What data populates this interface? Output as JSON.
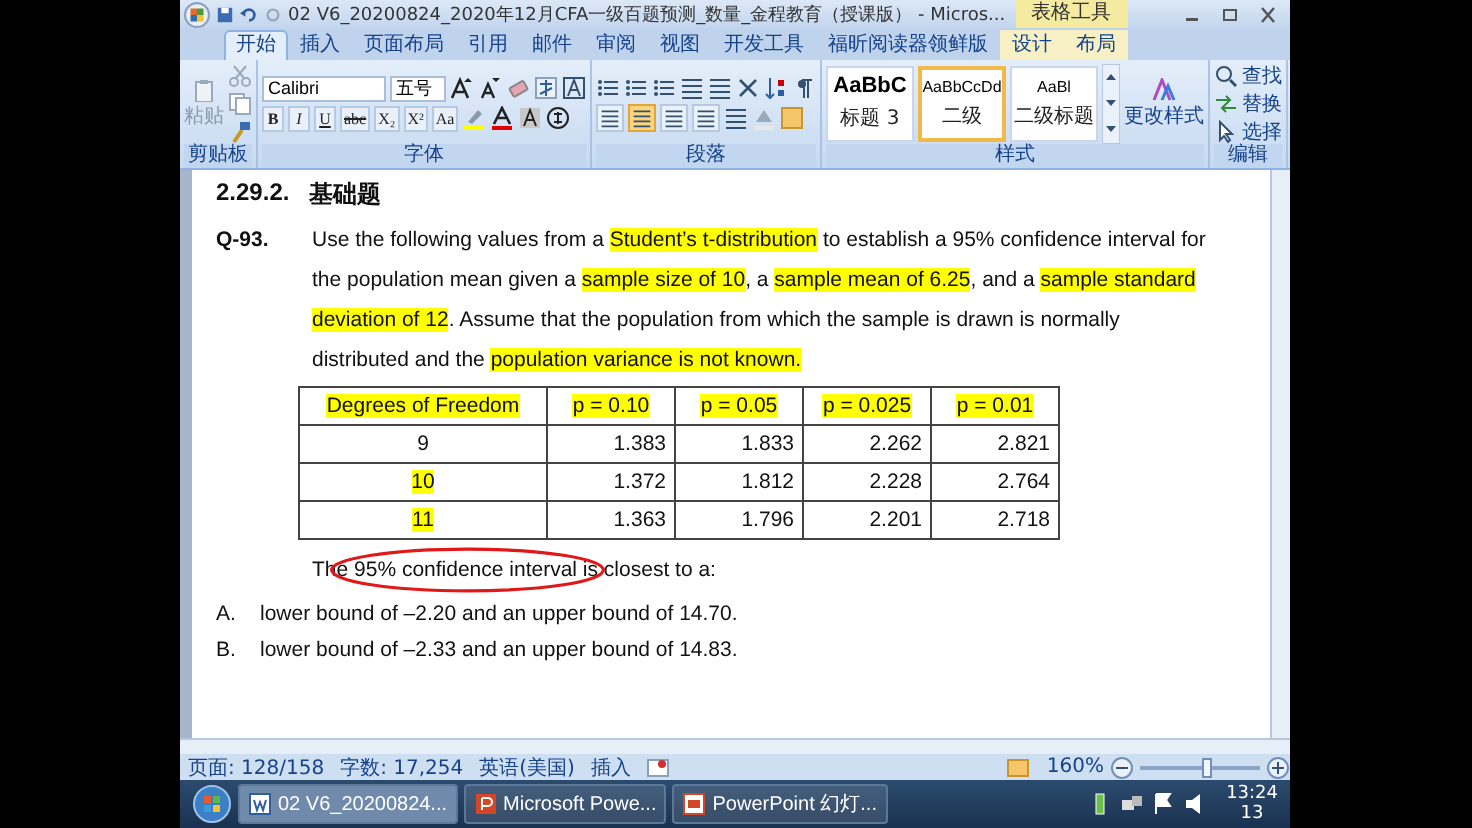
{
  "title_bar": {
    "title": "02 V6_20200824_2020年12月CFA一级百题预测_数量_金程教育（授课版） - Micros...",
    "context_group": "表格工具"
  },
  "tabs": [
    {
      "label": "开始",
      "selected": true
    },
    {
      "label": "插入",
      "selected": false
    },
    {
      "label": "页面布局",
      "selected": false
    },
    {
      "label": "引用",
      "selected": false
    },
    {
      "label": "邮件",
      "selected": false
    },
    {
      "label": "审阅",
      "selected": false
    },
    {
      "label": "视图",
      "selected": false
    },
    {
      "label": "开发工具",
      "selected": false
    },
    {
      "label": "福昕阅读器领鲜版",
      "selected": false
    },
    {
      "label": "设计",
      "selected": false
    },
    {
      "label": "布局",
      "selected": false
    }
  ],
  "ribbon": {
    "groups": [
      {
        "kind": "clipboard",
        "label": "剪贴板"
      },
      {
        "kind": "font",
        "label": "字体"
      },
      {
        "kind": "paragraph",
        "label": "段落"
      },
      {
        "kind": "styles",
        "label": "样式"
      },
      {
        "kind": "editing",
        "label": "编辑"
      }
    ],
    "paste": "粘贴",
    "font_name": "Calibri",
    "font_size": "五号",
    "font_buttons": [
      "B",
      "I",
      "U",
      "abc",
      "X₂",
      "X²",
      "Aa"
    ],
    "align_buttons": [
      {
        "selected": false
      },
      {
        "selected": true
      },
      {
        "selected": false
      },
      {
        "selected": false
      }
    ],
    "styles": [
      {
        "preview": "AaBbC",
        "name": "标题 3",
        "selected": false
      },
      {
        "preview": "AaBbCcDd",
        "name": "二级",
        "selected": true
      },
      {
        "preview": "AaBl",
        "name": "二级标题",
        "selected": false
      }
    ],
    "change_styles": "更改样式",
    "editing": [
      "查找",
      "替换",
      "选择"
    ]
  },
  "document": {
    "heading": {
      "number": "2.29.2.",
      "title": "基础题"
    },
    "question": {
      "number": "Q-93.",
      "segments": [
        {
          "text": "Use the following values from a ",
          "highlight": false
        },
        {
          "text": "Student’s t-distribution",
          "highlight": true
        },
        {
          "text": " to establish a 95% confidence interval for the population mean given a ",
          "highlight": false
        },
        {
          "text": "sample size of 10",
          "highlight": true
        },
        {
          "text": ", a ",
          "highlight": false
        },
        {
          "text": "sample mean of 6.25",
          "highlight": true
        },
        {
          "text": ", and a ",
          "highlight": false
        },
        {
          "text": "sample standard deviation of 12",
          "highlight": true
        },
        {
          "text": ". Assume that the population from which the sample is drawn is normally distributed and the ",
          "highlight": false
        },
        {
          "text": "population variance is not known.",
          "highlight": true
        }
      ]
    },
    "table": {
      "columns": [
        {
          "label": "Degrees of Freedom",
          "highlight": true
        },
        {
          "label": "p = 0.10",
          "highlight": true
        },
        {
          "label": "p = 0.05",
          "highlight": true
        },
        {
          "label": "p = 0.025",
          "highlight": true
        },
        {
          "label": "p = 0.01",
          "highlight": true
        }
      ],
      "rows": [
        {
          "highlight": false,
          "cells": [
            "9",
            "1.383",
            "1.833",
            "2.262",
            "2.821"
          ]
        },
        {
          "highlight": true,
          "cells": [
            "10",
            "1.372",
            "1.812",
            "2.228",
            "2.764"
          ]
        },
        {
          "highlight": true,
          "cells": [
            "11",
            "1.363",
            "1.796",
            "2.201",
            "2.718"
          ]
        }
      ]
    },
    "prompt": [
      {
        "text": "The ",
        "circled": false
      },
      {
        "text": "95% confidence interval",
        "circled": true
      },
      {
        "text": " is closest to a:",
        "circled": false
      }
    ],
    "options": [
      {
        "letter": "A.",
        "text": "lower bound of –2.20 and an upper bound of 14.70."
      },
      {
        "letter": "B.",
        "text": "lower bound of –2.33 and an upper bound of 14.83."
      }
    ]
  },
  "status_bar": {
    "page": "页面: 128/158",
    "words": "字数: 17,254",
    "language": "英语(美国)",
    "mode": "插入",
    "zoom": "160%",
    "zoom_slider": {
      "level": 0.55
    }
  },
  "taskbar": {
    "tasks": [
      {
        "kind": "word",
        "label": "02 V6_20200824...",
        "selected": true
      },
      {
        "kind": "powerpoint",
        "label": "Microsoft Powe...",
        "selected": false
      },
      {
        "kind": "slideshow",
        "label": "PowerPoint 幻灯...",
        "selected": false
      }
    ],
    "time": "13:24",
    "date": "13"
  }
}
